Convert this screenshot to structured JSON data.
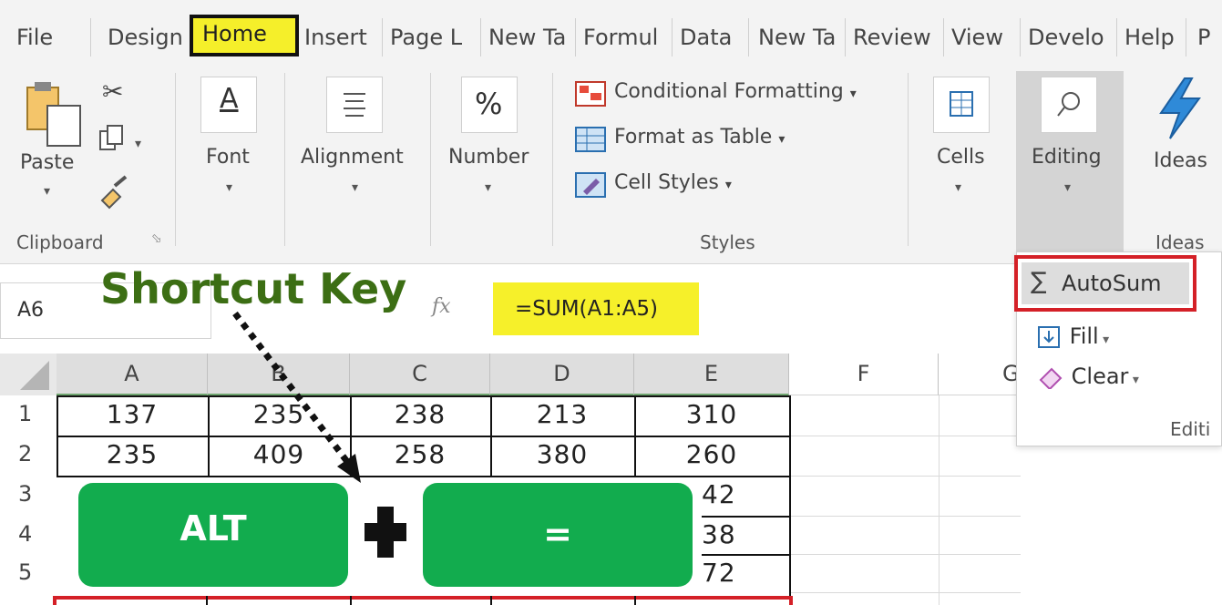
{
  "tabs": [
    {
      "label": "File"
    },
    {
      "label": "Design"
    },
    {
      "label": "Home"
    },
    {
      "label": "Insert"
    },
    {
      "label": "Page L"
    },
    {
      "label": "New Ta"
    },
    {
      "label": "Formul"
    },
    {
      "label": "Data"
    },
    {
      "label": "New Ta"
    },
    {
      "label": "Review"
    },
    {
      "label": "View"
    },
    {
      "label": "Develo"
    },
    {
      "label": "Help"
    },
    {
      "label": "P"
    }
  ],
  "ribbon": {
    "clipboard": {
      "paste": "Paste",
      "group": "Clipboard"
    },
    "font": "Font",
    "alignment": "Alignment",
    "number": "Number",
    "number_icon": "%",
    "styles": {
      "conditional": "Conditional Formatting",
      "format_table": "Format as Table",
      "cell_styles": "Cell Styles",
      "group": "Styles"
    },
    "cells": "Cells",
    "editing": "Editing",
    "ideas": "Ideas",
    "ideas_group": "Ideas"
  },
  "formula_bar": {
    "name_box": "A6",
    "fx": "fx",
    "formula": "=SUM(A1:A5)"
  },
  "overlay": {
    "title": "Shortcut Key",
    "key1": "ALT",
    "key2": "="
  },
  "grid": {
    "columns": [
      "A",
      "B",
      "C",
      "D",
      "E",
      "F",
      "G"
    ],
    "rows": [
      "1",
      "2",
      "3",
      "4",
      "5"
    ],
    "row1": [
      "137",
      "235",
      "238",
      "213",
      "310"
    ],
    "row2": [
      "235",
      "409",
      "258",
      "380",
      "260"
    ],
    "e_rest": [
      "42",
      "38",
      "72"
    ]
  },
  "dropdown": {
    "autosum": "AutoSum",
    "fill": "Fill",
    "clear": "Clear",
    "group": "Editi"
  },
  "colors": {
    "highlight": "#f5ef2a",
    "key_green": "#12ac4e",
    "title_green": "#3c6e14",
    "red_outline": "#d42027"
  }
}
